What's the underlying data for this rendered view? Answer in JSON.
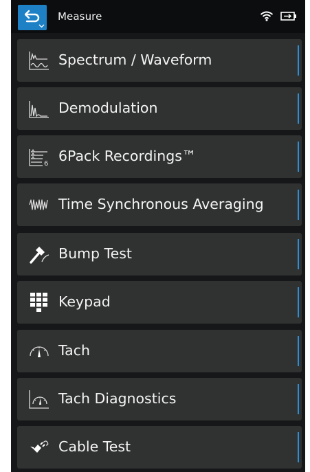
{
  "header": {
    "title": "Measure",
    "back_icon": "back-arrow-icon",
    "wifi_icon": "wifi-icon",
    "battery_icon": "battery-charging-icon"
  },
  "accent_color": "#2a8fd6",
  "menu": {
    "items": [
      {
        "label": "Spectrum / Waveform",
        "icon": "spectrum-waveform-icon"
      },
      {
        "label": "Demodulation",
        "icon": "demodulation-icon"
      },
      {
        "label": "6Pack Recordings™",
        "icon": "six-pack-recordings-icon"
      },
      {
        "label": "Time Synchronous Averaging",
        "icon": "time-synchronous-averaging-icon"
      },
      {
        "label": "Bump Test",
        "icon": "bump-test-hammer-icon"
      },
      {
        "label": "Keypad",
        "icon": "keypad-icon"
      },
      {
        "label": "Tach",
        "icon": "tach-gauge-icon"
      },
      {
        "label": "Tach Diagnostics",
        "icon": "tach-diagnostics-icon"
      },
      {
        "label": "Cable Test",
        "icon": "cable-test-icon"
      }
    ]
  }
}
